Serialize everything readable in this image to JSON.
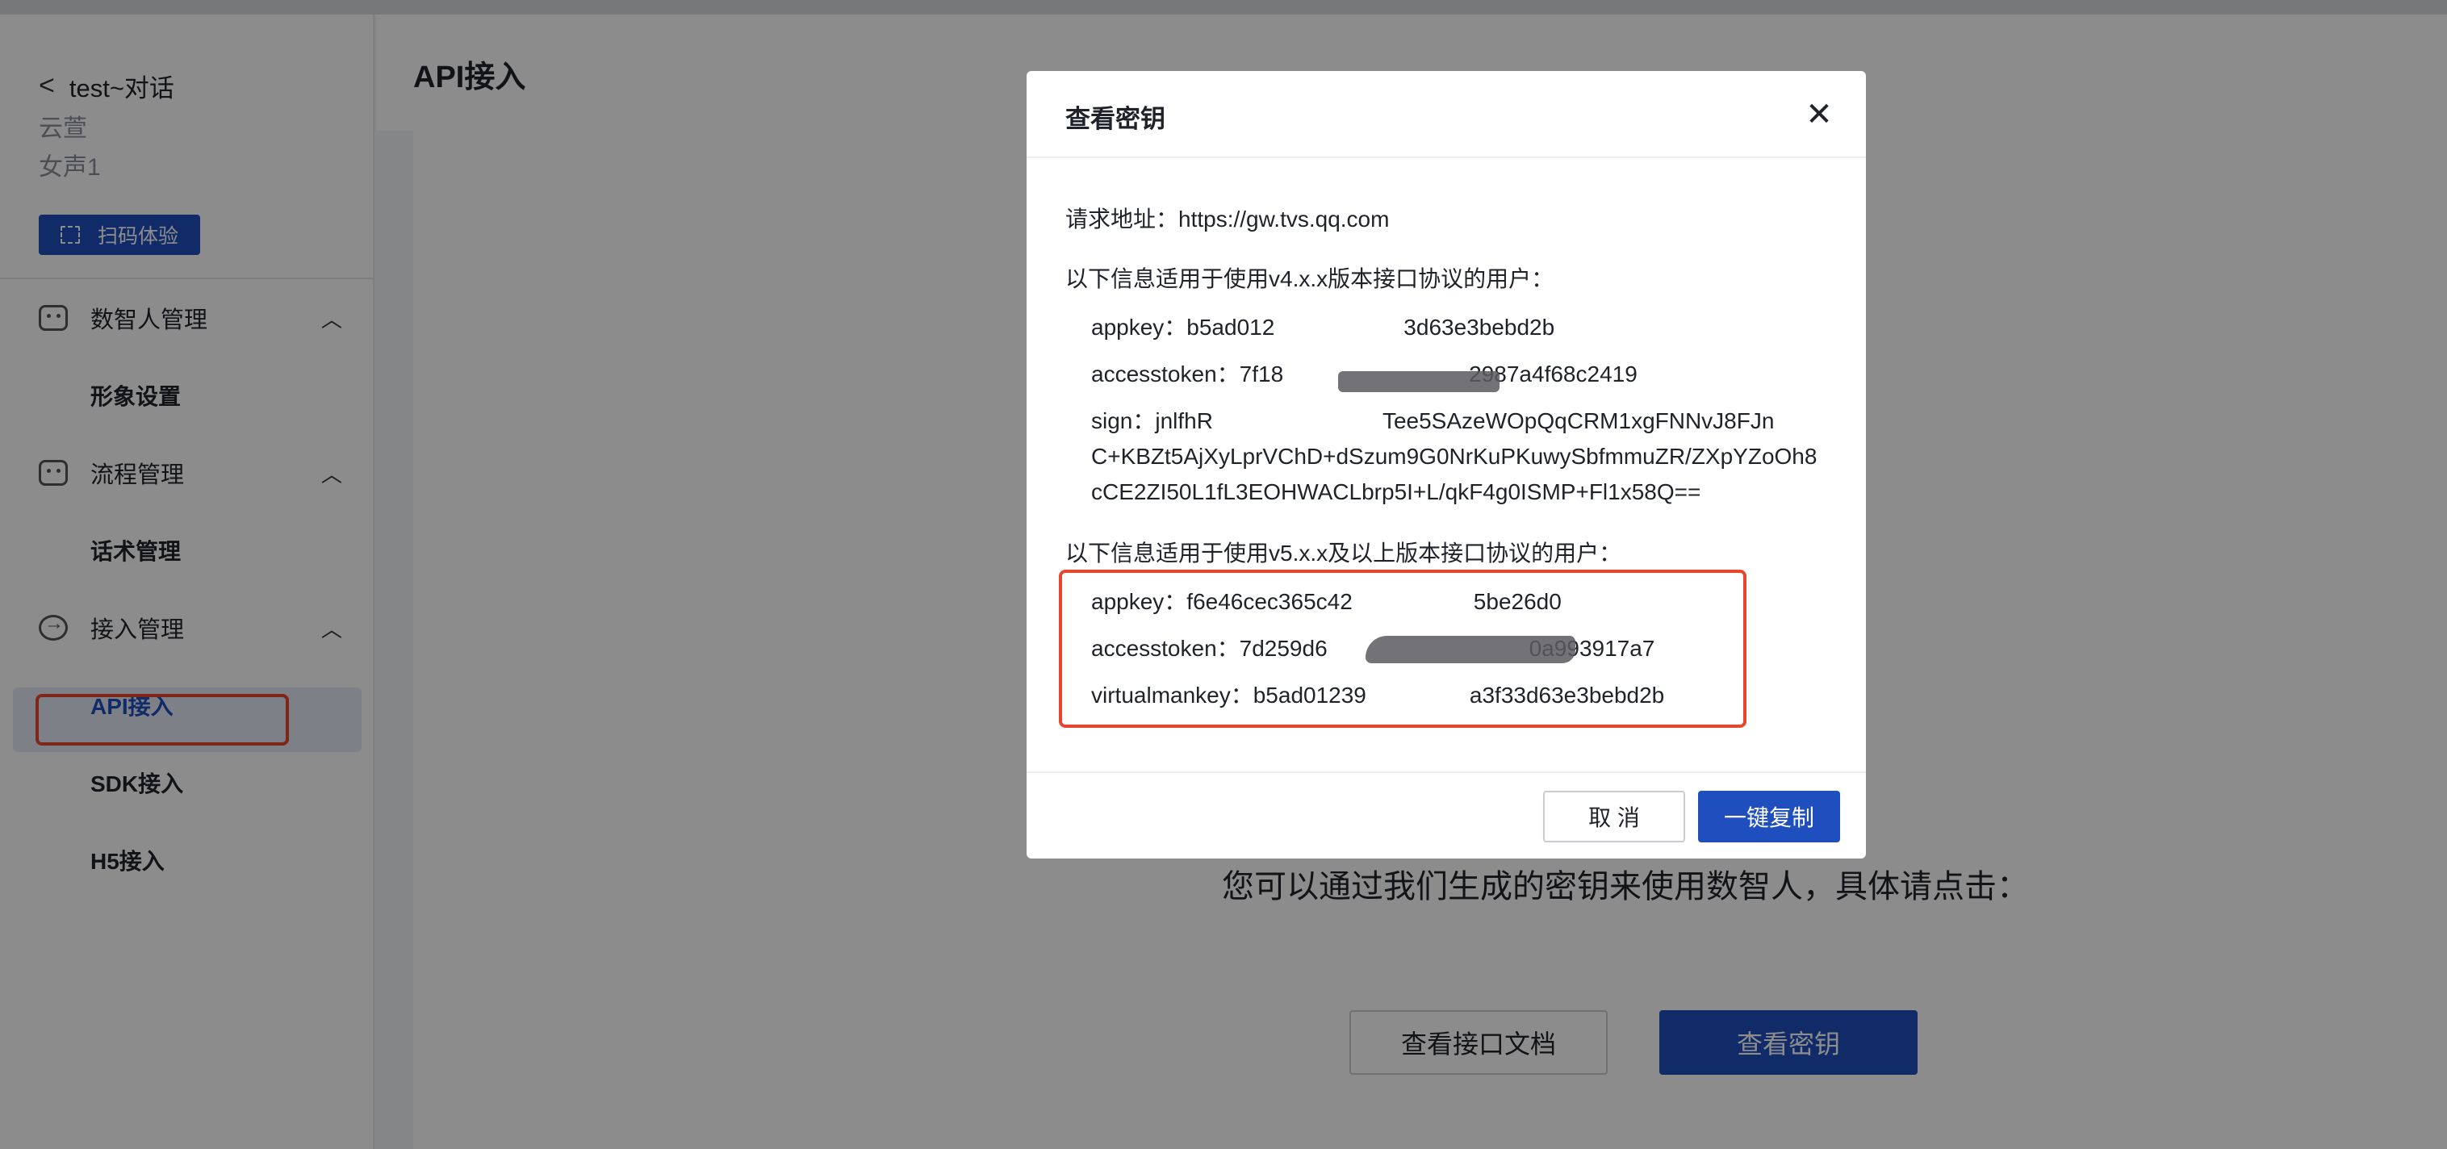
{
  "sidebar": {
    "back_label": "test~对话",
    "meta_line1": "云萱",
    "meta_line2": "女声1",
    "scan_label": "扫码体验",
    "groups": [
      {
        "label": "数智人管理",
        "items": [
          {
            "label": "形象设置"
          }
        ]
      },
      {
        "label": "流程管理",
        "items": [
          {
            "label": "话术管理"
          }
        ]
      },
      {
        "label": "接入管理",
        "items": [
          {
            "label": "API接入",
            "active": true
          },
          {
            "label": "SDK接入"
          },
          {
            "label": "H5接入"
          }
        ]
      }
    ]
  },
  "main": {
    "title": "API接入",
    "hint": "您可以通过我们生成的密钥来使用数智人，具体请点击：",
    "doc_button": "查看接口文档",
    "key_button": "查看密钥"
  },
  "modal": {
    "title": "查看密钥",
    "request_address": "请求地址：https://gw.tvs.qq.com",
    "v4_heading": "以下信息适用于使用v4.x.x版本接口协议的用户：",
    "v4": {
      "appkey": "appkey：b5ad012",
      "appkey_tail": "3d63e3bebd2b",
      "accesstoken": "accesstoken：7f18",
      "accesstoken_tail": "2987a4f68c2419",
      "sign_head": "sign：jnlfhR",
      "sign_rest": "C+KBZt5AjXyLprVChD+dSzum9G0NrKuPKuwySbfmmuZR/ZXpYZoOh8cCE2ZI50L1fL3EOHWACLbrp5I+L/qkF4g0ISMP+Fl1x58Q==",
      "sign_tail": "Tee5SAzeWOpQqCRM1xgFNNvJ8FJn"
    },
    "v5_heading": "以下信息适用于使用v5.x.x及以上版本接口协议的用户：",
    "v5": {
      "appkey": "appkey：f6e46cec365c42",
      "appkey_tail": "5be26d0",
      "accesstoken": "accesstoken：7d259d6",
      "accesstoken_tail": "0a993917a7",
      "virtualmankey": "virtualmankey：b5ad01239",
      "virtualmankey_tail": "a3f33d63e3bebd2b"
    },
    "cancel_label": "取 消",
    "copy_label": "一键复制"
  },
  "colors": {
    "primary": "#1f4fbf",
    "highlight_border": "#e8452f",
    "active_bg": "#e4eaf6"
  }
}
